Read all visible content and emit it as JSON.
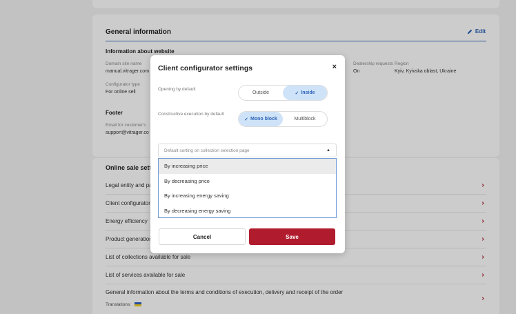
{
  "general": {
    "title": "General information",
    "edit_label": "Edit",
    "website_heading": "Information about website",
    "domain_label": "Domain site name",
    "domain_value": "manual.vitrager.com",
    "dealership_label": "Dealership requests",
    "dealership_value": "On",
    "region_label": "Region",
    "region_value": "Kyiv, Kyivska oblast, Ukraine",
    "configurator_type_label": "Configurator type",
    "configurator_type_value": "For online sell",
    "footer_heading": "Footer",
    "email_label": "Email for customer's",
    "email_value": "support@vitrager.co"
  },
  "sale": {
    "title": "Online sale settings",
    "rows": [
      "Legal entity and payment details",
      "Client configurator settings",
      "Energy efficiency",
      "Product generation",
      "List of collections available for sale",
      "List of services available for sale",
      "General information about the terms and conditions of execution, delivery and receipt of the order"
    ],
    "translations_label": "Translations:"
  },
  "modal": {
    "title": "Client configurator settings",
    "close_glyph": "×",
    "opening_label": "Opening by default",
    "opening_options": [
      "Outside",
      "Inside"
    ],
    "opening_selected": "Inside",
    "execution_label": "Constructive execution by default",
    "execution_options": [
      "Mono block",
      "Multiblock"
    ],
    "execution_selected": "Mono block",
    "sorting_placeholder": "Default sorting on collection selection page",
    "sorting_options": [
      "By increasing price",
      "By decreasing price",
      "By increasing energy saving",
      "By decreasing energy saving"
    ],
    "cancel_label": "Cancel",
    "save_label": "Save"
  },
  "icons": {
    "edit": "pencil-icon",
    "close": "close-icon",
    "check": "check-icon",
    "caret": "caret-up-icon",
    "row_arrow": "chevron-right-icon"
  },
  "colors": {
    "accent_blue": "#2e63b8",
    "save_red": "#b01c2e",
    "active_toggle_bg": "#cfe3f8"
  }
}
